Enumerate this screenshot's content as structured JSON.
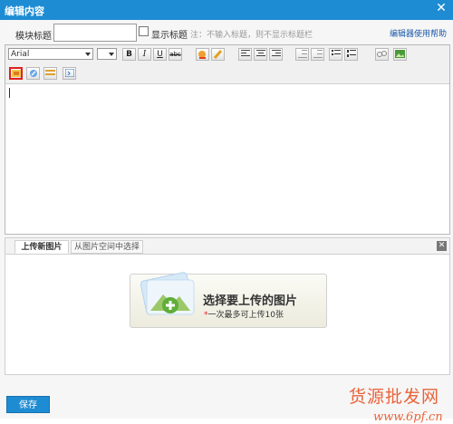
{
  "window": {
    "title": "编辑内容",
    "close_label": "✕"
  },
  "form": {
    "module_title_label": "模块标题：",
    "module_title_value": "",
    "show_title_label": "显示标题",
    "note": "注：不输入标题，则不显示标题栏",
    "help_link": "编辑器使用帮助"
  },
  "toolbar": {
    "font_family": "Arial",
    "font_size": "",
    "bold": "B",
    "italic": "I",
    "underline": "U",
    "strike": "abc"
  },
  "upload_panel": {
    "tabs": [
      "上传新图片",
      "从图片空间中选择"
    ],
    "active_tab": 0,
    "upload_title": "选择要上传的图片",
    "upload_star": "*",
    "upload_sub": "一次最多可上传10张",
    "close_label": "✕"
  },
  "footer": {
    "save_label": "保存"
  },
  "watermark": {
    "line1": "货源批发网",
    "line2": "www.6pf.cn"
  },
  "colors": {
    "accent": "#1e8cd3",
    "highlight": "#e02020",
    "watermark": "#e9633a"
  }
}
